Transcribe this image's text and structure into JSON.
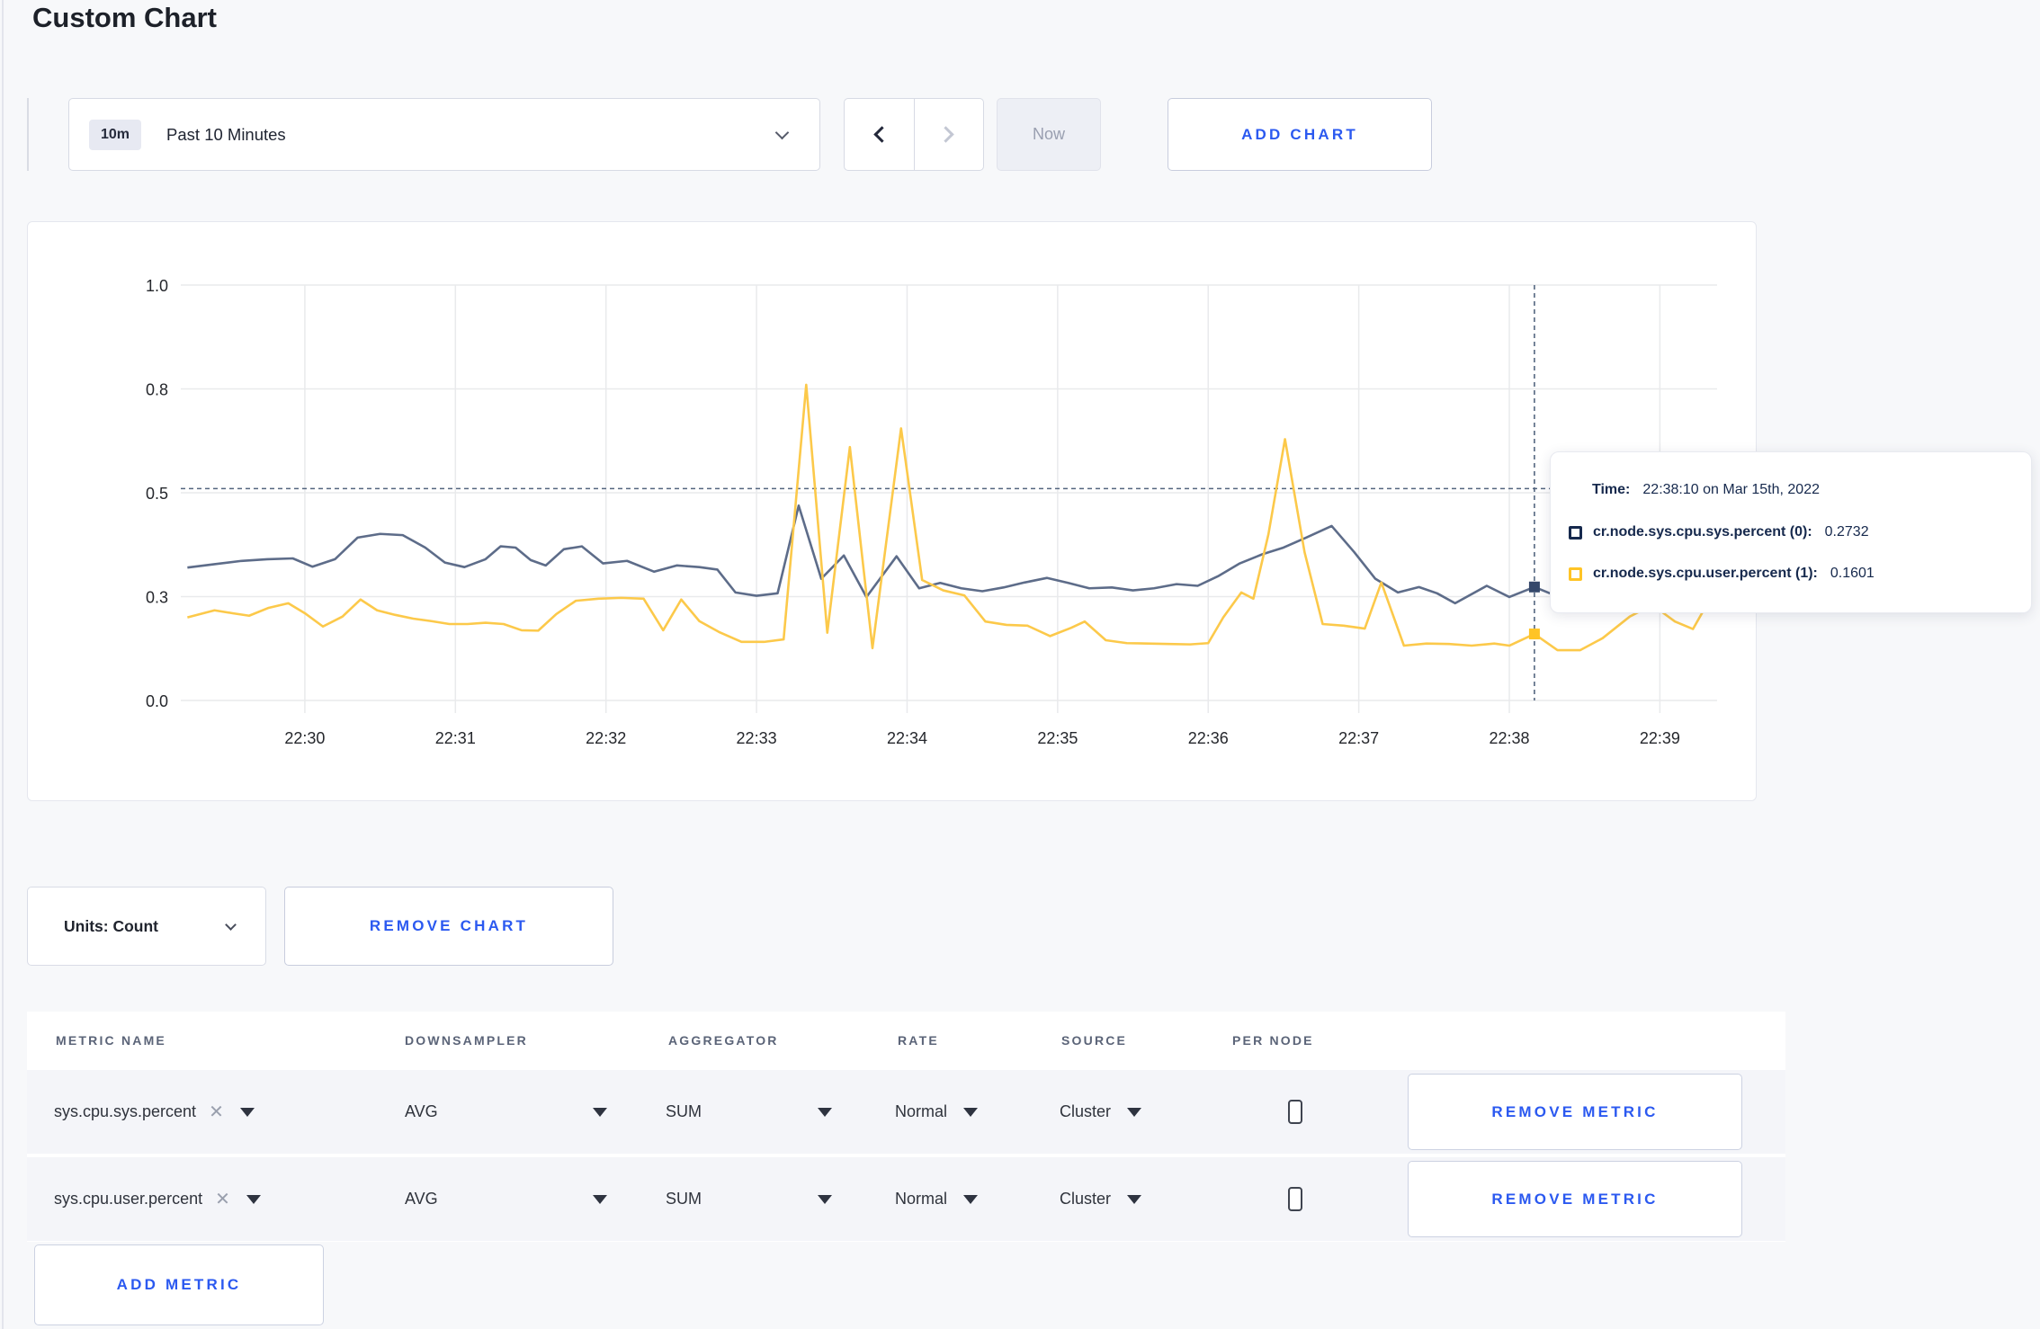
{
  "page": {
    "title": "Custom Chart",
    "accent_blue": "#2b59f0",
    "background": "#f7f8fa"
  },
  "toolbar": {
    "time_range": {
      "badge": "10m",
      "label": "Past 10 Minutes"
    },
    "now_label": "Now",
    "add_chart_label": "ADD CHART"
  },
  "chart_data": {
    "type": "line",
    "title": "",
    "xlabel": "",
    "ylabel": "",
    "grid": true,
    "x_axis": {
      "note": "x values are minutes after 22:29:00",
      "domain_minutes": [
        0.176,
        10.38
      ],
      "tick_minutes": [
        1,
        2,
        3,
        4,
        5,
        6,
        7,
        8,
        9,
        10
      ],
      "tick_labels": [
        "22:30",
        "22:31",
        "22:32",
        "22:33",
        "22:34",
        "22:35",
        "22:36",
        "22:37",
        "22:38",
        "22:39"
      ]
    },
    "y_axis": {
      "range": [
        0,
        1
      ],
      "tick_values": [
        0,
        0.25,
        0.5,
        0.75,
        1.0
      ],
      "tick_labels": [
        "0.0",
        "0.3",
        "0.5",
        "0.8",
        "1.0"
      ]
    },
    "grid_color": "#e9eaec",
    "series": [
      {
        "name": "cr.node.sys.cpu.sys.percent",
        "color": "#5d6c89",
        "points": [
          [
            0.22,
            0.32
          ],
          [
            0.4,
            0.328
          ],
          [
            0.58,
            0.336
          ],
          [
            0.75,
            0.34
          ],
          [
            0.92,
            0.342
          ],
          [
            1.05,
            0.322
          ],
          [
            1.2,
            0.34
          ],
          [
            1.35,
            0.392
          ],
          [
            1.5,
            0.401
          ],
          [
            1.65,
            0.398
          ],
          [
            1.8,
            0.368
          ],
          [
            1.93,
            0.332
          ],
          [
            2.06,
            0.321
          ],
          [
            2.2,
            0.34
          ],
          [
            2.3,
            0.371
          ],
          [
            2.4,
            0.368
          ],
          [
            2.5,
            0.338
          ],
          [
            2.6,
            0.325
          ],
          [
            2.72,
            0.364
          ],
          [
            2.84,
            0.371
          ],
          [
            2.98,
            0.33
          ],
          [
            3.14,
            0.336
          ],
          [
            3.32,
            0.31
          ],
          [
            3.47,
            0.325
          ],
          [
            3.62,
            0.321
          ],
          [
            3.74,
            0.315
          ],
          [
            3.86,
            0.26
          ],
          [
            4.0,
            0.252
          ],
          [
            4.14,
            0.258
          ],
          [
            4.28,
            0.469
          ],
          [
            4.43,
            0.293
          ],
          [
            4.58,
            0.349
          ],
          [
            4.73,
            0.249
          ],
          [
            4.93,
            0.347
          ],
          [
            5.08,
            0.27
          ],
          [
            5.22,
            0.283
          ],
          [
            5.36,
            0.27
          ],
          [
            5.5,
            0.263
          ],
          [
            5.64,
            0.272
          ],
          [
            5.78,
            0.284
          ],
          [
            5.93,
            0.295
          ],
          [
            6.07,
            0.283
          ],
          [
            6.21,
            0.27
          ],
          [
            6.36,
            0.272
          ],
          [
            6.5,
            0.265
          ],
          [
            6.64,
            0.27
          ],
          [
            6.79,
            0.28
          ],
          [
            6.93,
            0.276
          ],
          [
            7.07,
            0.3
          ],
          [
            7.21,
            0.33
          ],
          [
            7.36,
            0.352
          ],
          [
            7.5,
            0.368
          ],
          [
            7.65,
            0.392
          ],
          [
            7.82,
            0.42
          ],
          [
            7.97,
            0.357
          ],
          [
            8.11,
            0.293
          ],
          [
            8.26,
            0.26
          ],
          [
            8.4,
            0.273
          ],
          [
            8.52,
            0.258
          ],
          [
            8.64,
            0.234
          ],
          [
            8.85,
            0.276
          ],
          [
            9.0,
            0.249
          ],
          [
            9.1667,
            0.2732
          ],
          [
            9.31,
            0.252
          ],
          [
            9.46,
            0.262
          ],
          [
            9.62,
            0.274
          ],
          [
            9.78,
            0.284
          ],
          [
            9.95,
            0.296
          ],
          [
            10.12,
            0.305
          ],
          [
            10.28,
            0.308
          ]
        ]
      },
      {
        "name": "cr.node.sys.cpu.user.percent",
        "color": "#fcc94a",
        "points": [
          [
            0.22,
            0.2
          ],
          [
            0.4,
            0.217
          ],
          [
            0.52,
            0.21
          ],
          [
            0.63,
            0.204
          ],
          [
            0.76,
            0.223
          ],
          [
            0.89,
            0.234
          ],
          [
            1.0,
            0.21
          ],
          [
            1.12,
            0.178
          ],
          [
            1.25,
            0.202
          ],
          [
            1.37,
            0.243
          ],
          [
            1.48,
            0.217
          ],
          [
            1.6,
            0.206
          ],
          [
            1.72,
            0.197
          ],
          [
            1.84,
            0.191
          ],
          [
            1.96,
            0.184
          ],
          [
            2.08,
            0.184
          ],
          [
            2.2,
            0.187
          ],
          [
            2.32,
            0.184
          ],
          [
            2.44,
            0.169
          ],
          [
            2.55,
            0.168
          ],
          [
            2.67,
            0.208
          ],
          [
            2.8,
            0.24
          ],
          [
            2.95,
            0.245
          ],
          [
            3.1,
            0.247
          ],
          [
            3.25,
            0.245
          ],
          [
            3.38,
            0.169
          ],
          [
            3.5,
            0.243
          ],
          [
            3.62,
            0.191
          ],
          [
            3.75,
            0.165
          ],
          [
            3.9,
            0.141
          ],
          [
            4.05,
            0.141
          ],
          [
            4.18,
            0.147
          ],
          [
            4.33,
            0.76
          ],
          [
            4.47,
            0.163
          ],
          [
            4.62,
            0.61
          ],
          [
            4.77,
            0.126
          ],
          [
            4.96,
            0.655
          ],
          [
            5.1,
            0.29
          ],
          [
            5.24,
            0.265
          ],
          [
            5.38,
            0.253
          ],
          [
            5.52,
            0.19
          ],
          [
            5.66,
            0.182
          ],
          [
            5.8,
            0.18
          ],
          [
            5.95,
            0.155
          ],
          [
            6.09,
            0.175
          ],
          [
            6.18,
            0.19
          ],
          [
            6.32,
            0.145
          ],
          [
            6.46,
            0.138
          ],
          [
            6.6,
            0.137
          ],
          [
            6.74,
            0.136
          ],
          [
            6.88,
            0.135
          ],
          [
            7.0,
            0.138
          ],
          [
            7.1,
            0.2
          ],
          [
            7.22,
            0.26
          ],
          [
            7.3,
            0.245
          ],
          [
            7.4,
            0.4
          ],
          [
            7.51,
            0.629
          ],
          [
            7.64,
            0.357
          ],
          [
            7.76,
            0.184
          ],
          [
            7.9,
            0.18
          ],
          [
            8.04,
            0.173
          ],
          [
            8.15,
            0.284
          ],
          [
            8.3,
            0.132
          ],
          [
            8.45,
            0.137
          ],
          [
            8.6,
            0.136
          ],
          [
            8.75,
            0.132
          ],
          [
            8.9,
            0.137
          ],
          [
            9.0,
            0.132
          ],
          [
            9.1667,
            0.1601
          ],
          [
            9.32,
            0.121
          ],
          [
            9.47,
            0.121
          ],
          [
            9.62,
            0.15
          ],
          [
            9.8,
            0.202
          ],
          [
            9.95,
            0.23
          ],
          [
            10.1,
            0.19
          ],
          [
            10.22,
            0.172
          ],
          [
            10.35,
            0.255
          ]
        ]
      }
    ],
    "crosshair": {
      "x_minutes": 9.1667,
      "y_value": 0.51,
      "color": "#54657f"
    },
    "highlight_dots": [
      {
        "series": 0,
        "x_minutes": 9.1667,
        "value": 0.2732,
        "color": "#35486b"
      },
      {
        "series": 1,
        "x_minutes": 9.1667,
        "value": 0.1601,
        "color": "#ffc426"
      }
    ],
    "legend_position": "tooltip-only"
  },
  "tooltip": {
    "time_label": "Time:",
    "time_value": "22:38:10 on Mar 15th, 2022",
    "rows": [
      {
        "label": "cr.node.sys.cpu.sys.percent (0):",
        "value": "0.2732",
        "swatch_color": "#16294d"
      },
      {
        "label": "cr.node.sys.cpu.user.percent (1):",
        "value": "0.1601",
        "swatch_color": "#ffc426"
      }
    ]
  },
  "chart_footer": {
    "units_label": "Units: Count",
    "remove_chart_label": "REMOVE CHART"
  },
  "icons": {
    "remove_x": "✕"
  },
  "metrics_table": {
    "headers": [
      "METRIC NAME",
      "DOWNSAMPLER",
      "AGGREGATOR",
      "RATE",
      "SOURCE",
      "PER NODE"
    ],
    "rows": [
      {
        "metric": "sys.cpu.sys.percent",
        "downsampler": "AVG",
        "aggregator": "SUM",
        "rate": "Normal",
        "source": "Cluster",
        "per_node_checked": false,
        "remove_label": "REMOVE METRIC"
      },
      {
        "metric": "sys.cpu.user.percent",
        "downsampler": "AVG",
        "aggregator": "SUM",
        "rate": "Normal",
        "source": "Cluster",
        "per_node_checked": false,
        "remove_label": "REMOVE METRIC"
      }
    ],
    "add_metric_label": "ADD METRIC"
  }
}
